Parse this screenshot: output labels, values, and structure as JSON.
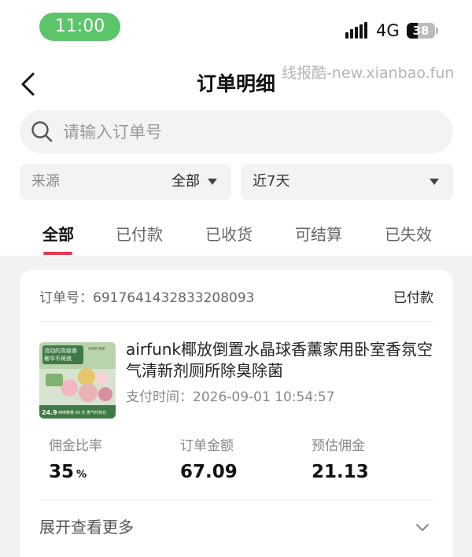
{
  "status_bar": {
    "time": "11:00",
    "network": "4G",
    "battery_level": "38",
    "battery_fraction": 0.38
  },
  "header": {
    "back_icon": "chevron-left-icon",
    "title": "订单明细",
    "watermark": "线报酷-new.xianbao.fun"
  },
  "search": {
    "icon": "search-icon",
    "placeholder": "请输入订单号",
    "value": ""
  },
  "filters": {
    "source_label": "来源",
    "source_value": "全部",
    "date_value": "近7天"
  },
  "tabs": [
    {
      "label": "全部",
      "active": true
    },
    {
      "label": "已付款",
      "active": false
    },
    {
      "label": "已收货",
      "active": false
    },
    {
      "label": "可结算",
      "active": false
    },
    {
      "label": "已失效",
      "active": false
    }
  ],
  "order": {
    "order_no": "订单号：6917641432833208093",
    "status": "已付款",
    "product_title": "airfunk椰放倒置水晶球香薰家用卧室香氛空气清新剂厕所除臭除菌",
    "pay_time": "支付时间：2026-09-01 10:54:57",
    "product_image": {
      "brand": "AIRFUNK",
      "headline1": "流动的高级香",
      "headline2": "奢华不将就",
      "price": "24.9",
      "footer": "持续散香 60 天 香气时刻在"
    },
    "stats": [
      {
        "label": "佣金比率",
        "value": "35",
        "unit": "%"
      },
      {
        "label": "订单金额",
        "value": "67.09",
        "unit": ""
      },
      {
        "label": "预估佣金",
        "value": "21.13",
        "unit": ""
      }
    ],
    "expand_label": "展开查看更多"
  },
  "colors": {
    "accent": "#e8384f",
    "time_pill": "#5cc56a"
  }
}
